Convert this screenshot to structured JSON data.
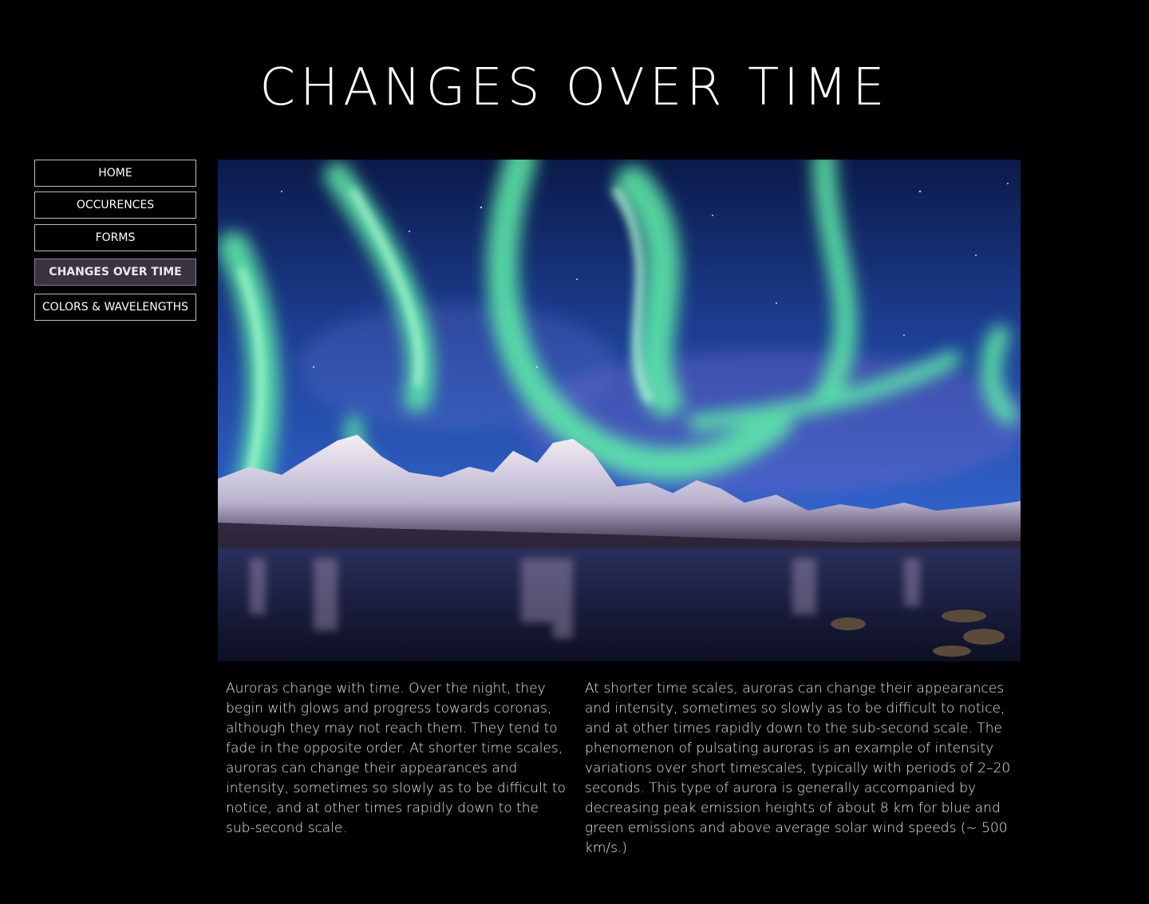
{
  "page": {
    "title": "CHANGES OVER TIME"
  },
  "nav": {
    "items": [
      {
        "label": "HOME",
        "active": false
      },
      {
        "label": "OCCURENCES",
        "active": false
      },
      {
        "label": "FORMS",
        "active": false
      },
      {
        "label": "CHANGES OVER TIME",
        "active": true
      },
      {
        "label": "COLORS & WAVELENGTHS",
        "active": false
      }
    ]
  },
  "hero": {
    "subject": "aurora-over-snowy-mountains-and-lake"
  },
  "content": {
    "left_paragraph": "Auroras change with time. Over the night, they begin with glows and progress towards coronas, although they may not reach them. They tend to fade in the opposite order. At shorter time scales, auroras can change their appearances and intensity, sometimes so slowly as to be difficult to notice, and at other times rapidly down to the sub-second scale.",
    "right_paragraph": "At shorter time scales, auroras can change their appearances and intensity, sometimes so slowly as to be difficult to notice, and at other times rapidly down to the sub-second scale. The phenomenon of pulsating auroras is an example of intensity variations over short timescales, typically with periods of 2–20 seconds. This type of aurora is generally accompanied by decreasing peak emission heights of about 8 km for blue and green emissions and above average solar wind speeds (~ 500 km/s.)"
  },
  "colors": {
    "background": "#000000",
    "active_nav_bg": "#3a3340",
    "aurora_green": "#5ef0a8",
    "sky_blue": "#2f62c9"
  }
}
